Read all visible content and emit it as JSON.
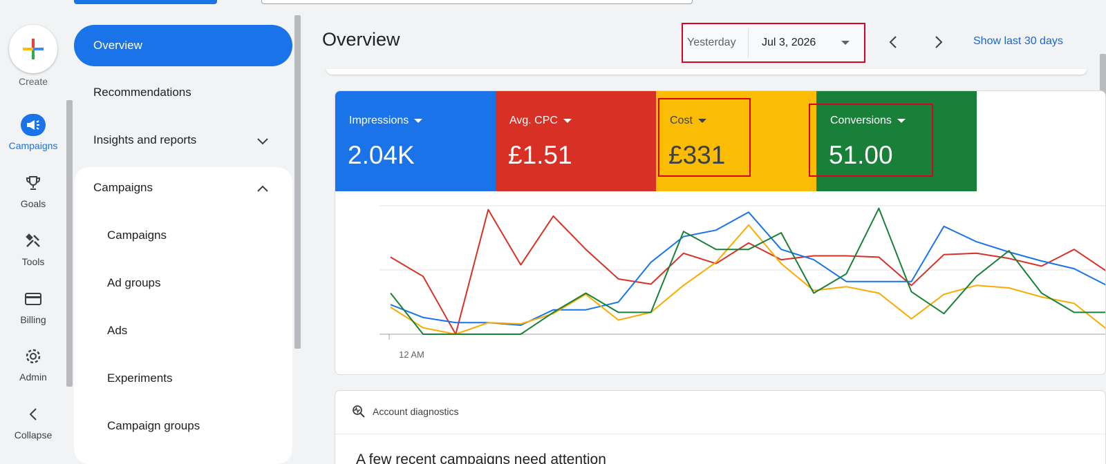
{
  "rail": {
    "create_label": "Create",
    "items": [
      {
        "label": "Campaigns",
        "icon": "megaphone-icon",
        "active": true
      },
      {
        "label": "Goals",
        "icon": "trophy-icon",
        "active": false
      },
      {
        "label": "Tools",
        "icon": "tools-icon",
        "active": false
      },
      {
        "label": "Billing",
        "icon": "credit-card-icon",
        "active": false
      },
      {
        "label": "Admin",
        "icon": "gear-icon",
        "active": false
      },
      {
        "label": "Collapse",
        "icon": "chevron-left-icon",
        "active": false
      }
    ]
  },
  "nav": {
    "overview": "Overview",
    "recommendations": "Recommendations",
    "insights": "Insights and reports",
    "campaigns_group": "Campaigns",
    "sub": [
      "Campaigns",
      "Ad groups",
      "Ads",
      "Experiments",
      "Campaign groups"
    ]
  },
  "header": {
    "title": "Overview",
    "date_label": "Yesterday",
    "date_value": "Jul 3, 2026",
    "show_last": "Show last 30 days"
  },
  "metrics": [
    {
      "label": "Impressions",
      "value": "2.04K",
      "color": "#1a73e8"
    },
    {
      "label": "Avg. CPC",
      "value": "£1.51",
      "color": "#d93025"
    },
    {
      "label": "Cost",
      "value": "£331",
      "color": "#fbbc04"
    },
    {
      "label": "Conversions",
      "value": "51.00",
      "color": "#188038"
    }
  ],
  "chart_data": {
    "type": "line",
    "x_tick_label": "12 AM",
    "grid": true,
    "series": [
      {
        "color": "#d93025",
        "values": [
          60,
          45,
          0,
          97,
          54,
          92,
          66,
          43,
          39,
          63,
          55,
          71,
          58,
          61,
          61,
          60,
          38,
          62,
          63,
          59,
          53,
          66,
          49
        ]
      },
      {
        "color": "#1a73e8",
        "values": [
          23,
          13,
          9,
          9,
          7,
          19,
          19,
          25,
          56,
          76,
          81,
          95,
          66,
          58,
          41,
          41,
          41,
          84,
          72,
          64,
          57,
          51,
          38
        ]
      },
      {
        "color": "#f9ab00",
        "values": [
          21,
          5,
          0,
          9,
          8,
          16,
          31,
          11,
          17,
          38,
          56,
          85,
          55,
          34,
          37,
          32,
          12,
          31,
          38,
          36,
          29,
          24,
          4
        ]
      },
      {
        "color": "#188038",
        "values": [
          32,
          0,
          0,
          0,
          0,
          17,
          32,
          17,
          17,
          80,
          66,
          66,
          79,
          32,
          47,
          98,
          33,
          16,
          45,
          65,
          32,
          17,
          17
        ]
      }
    ]
  },
  "diagnostics": {
    "heading": "Account diagnostics",
    "message": "A few recent campaigns need attention"
  }
}
